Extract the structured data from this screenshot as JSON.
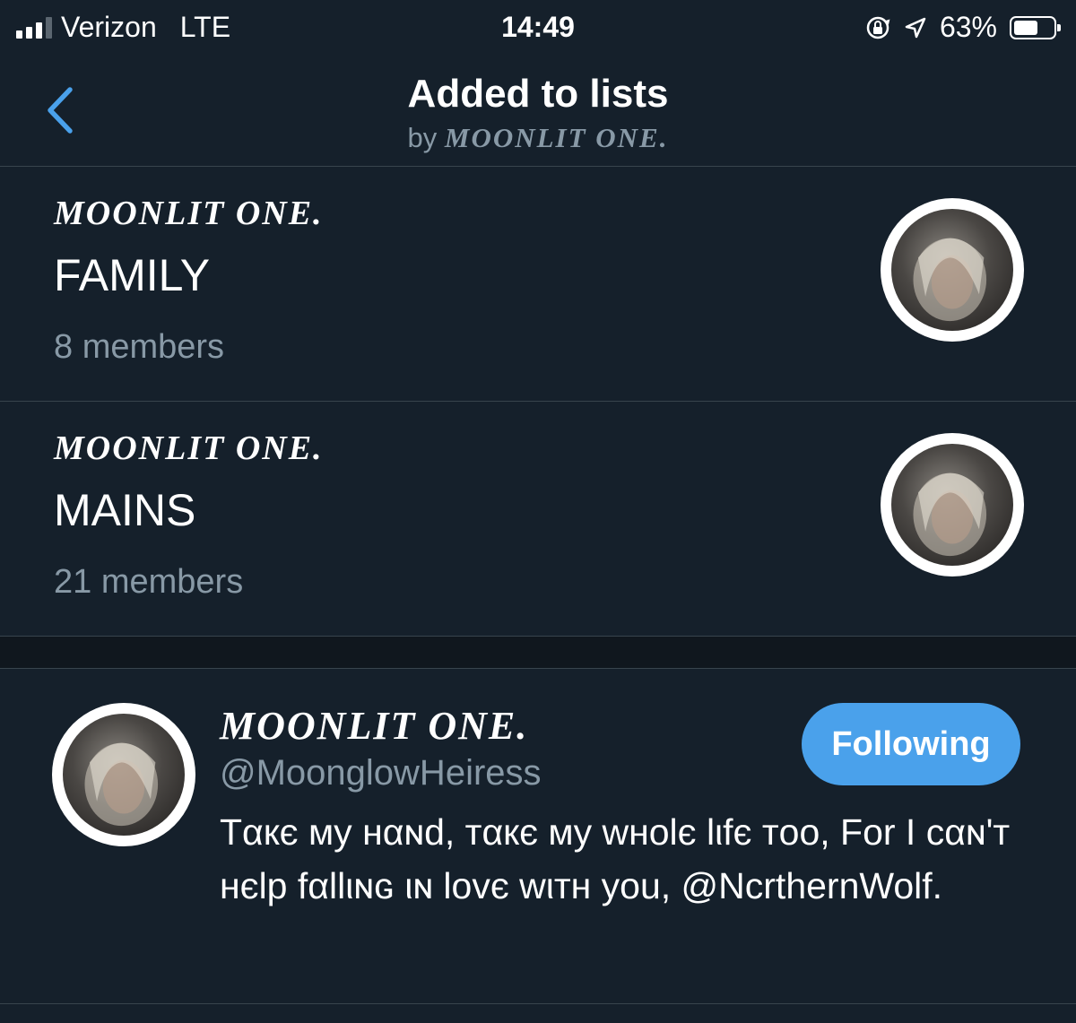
{
  "status_bar": {
    "carrier": "Verizon",
    "network": "LTE",
    "time": "14:49",
    "battery_percent": "63%",
    "battery_level": 0.63,
    "icons": [
      "signal-icon",
      "orientation-lock-icon",
      "location-icon",
      "battery-icon"
    ]
  },
  "nav": {
    "title": "Added to lists",
    "subtitle_prefix": "by",
    "subtitle_name": "MOONLIT ONE."
  },
  "lists": [
    {
      "owner": "MOONLIT ONE.",
      "name": "FAMILY",
      "members": "8 members"
    },
    {
      "owner": "MOONLIT ONE.",
      "name": "MAINS",
      "members": "21 members"
    }
  ],
  "user": {
    "name": "MOONLIT ONE.",
    "handle": "@MoonglowHeiress",
    "bio": "Tαкє мy нαɴd, тαкє мy wнolє lιfє тoo, For I cαɴ'т нєlp fαllιɴɢ ιɴ lovє wιтн you, @NcrthernWolf.",
    "follow_label": "Following"
  },
  "colors": {
    "background": "#15202b",
    "divider": "#38444d",
    "secondary_text": "#8899a6",
    "accent": "#4aa1eb"
  }
}
